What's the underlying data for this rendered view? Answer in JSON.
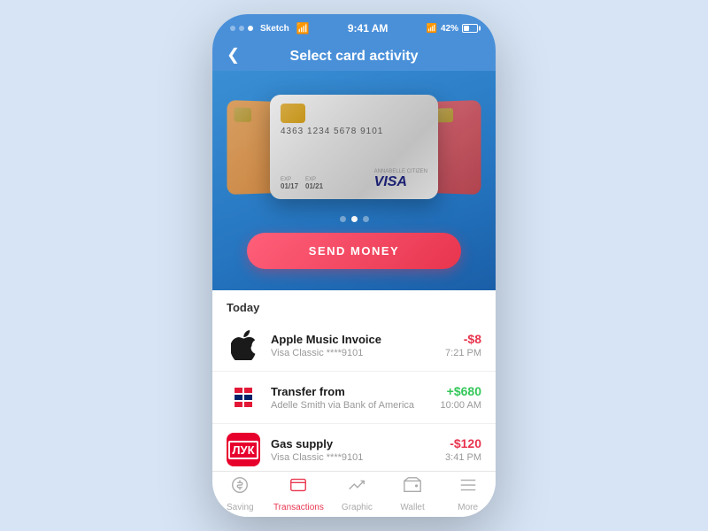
{
  "statusBar": {
    "time": "9:41 AM",
    "battery": "42%",
    "wifi": "WiFi"
  },
  "header": {
    "title": "Select card activity",
    "back": "‹"
  },
  "card": {
    "number": "4363  1234  5678  9101",
    "expFrom": "01/17",
    "expTo": "01/21",
    "holder": "ANNABELLE CITIZEN",
    "brand": "VISA"
  },
  "cardDots": [
    false,
    true,
    false
  ],
  "sendButton": "SEND MONEY",
  "sectionLabel": "Today",
  "transactions": [
    {
      "name": "Apple Music Invoice",
      "sub": "Visa Classic ****9101",
      "time": "7:21 PM",
      "amount": "-$8",
      "positive": false,
      "iconType": "apple"
    },
    {
      "name": "Transfer from",
      "sub": "Adelle Smith via  Bank of America",
      "time": "10:00 AM",
      "amount": "+$680",
      "positive": true,
      "iconType": "bofa"
    },
    {
      "name": "Gas supply",
      "sub": "Visa Classic ****9101",
      "time": "3:41 PM",
      "amount": "-$120",
      "positive": false,
      "iconType": "lukoil"
    }
  ],
  "bottomNav": [
    {
      "label": "Saving",
      "icon": "saving",
      "active": false
    },
    {
      "label": "Transactions",
      "icon": "transactions",
      "active": true
    },
    {
      "label": "Graphic",
      "icon": "graphic",
      "active": false
    },
    {
      "label": "Wallet",
      "icon": "wallet",
      "active": false
    },
    {
      "label": "More",
      "icon": "more",
      "active": false
    }
  ]
}
